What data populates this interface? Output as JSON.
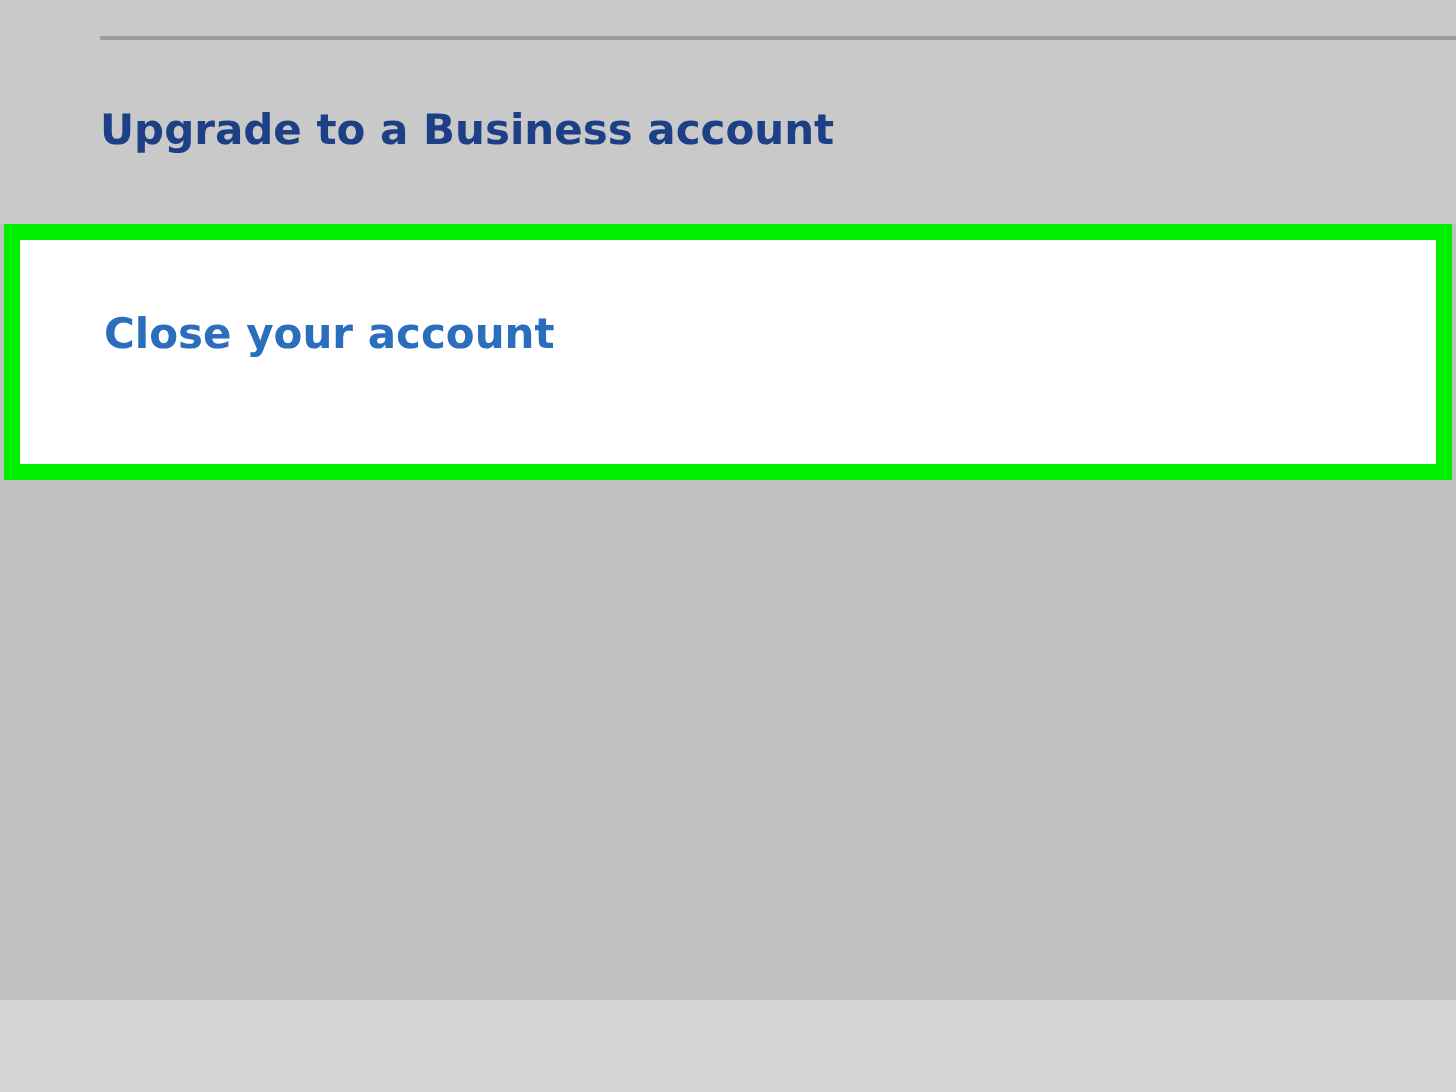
{
  "menu_items": [
    {
      "label": "Upgrade to a Business account",
      "highlighted": false
    },
    {
      "label": "Close your account",
      "highlighted": true
    }
  ]
}
